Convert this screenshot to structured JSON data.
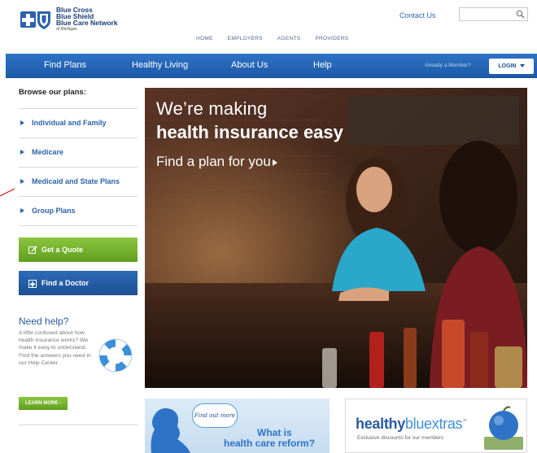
{
  "header": {
    "logo_lines": [
      "Blue Cross",
      "Blue Shield",
      "Blue Care Network"
    ],
    "logo_small": "of Michigan",
    "contact_label": "Contact Us",
    "search_placeholder": "",
    "top_nav": [
      "HOME",
      "EMPLOYERS",
      "AGENTS",
      "PROVIDERS"
    ]
  },
  "main_nav": {
    "items": [
      "Find Plans",
      "Healthy Living",
      "About Us",
      "Help"
    ],
    "member_text": "Already a Member?",
    "login_label": "LOGIN"
  },
  "sidebar": {
    "browse_title": "Browse our plans:",
    "plans": [
      "Individual and Family",
      "Medicare",
      "Medicaid and State Plans",
      "Group Plans"
    ],
    "quote_label": "Get a Quote",
    "doctor_label": "Find a Doctor",
    "need_help_title": "Need help?",
    "help_text": "A little confused about how health insurance works? We make it easy to understand. Find the answers you need in our Help Center.",
    "learn_more_label": "LEARN MORE ›"
  },
  "hero": {
    "line1": "We’re making",
    "line2": "health insurance easy",
    "line3": "Find a plan for you"
  },
  "promos": {
    "reform_bubble": "Find out more",
    "reform_line1": "What is",
    "reform_line2": "health care reform?",
    "extras_brand_part1": "healthy",
    "extras_brand_part2": "bluextras",
    "extras_tm": "℠",
    "extras_sub": "Exclusive discounts for our members"
  },
  "colors": {
    "nav_blue": "#1c5aa6",
    "link_blue": "#2d63ac",
    "quote_green": "#6aa82a",
    "doctor_blue": "#1d4f93"
  }
}
